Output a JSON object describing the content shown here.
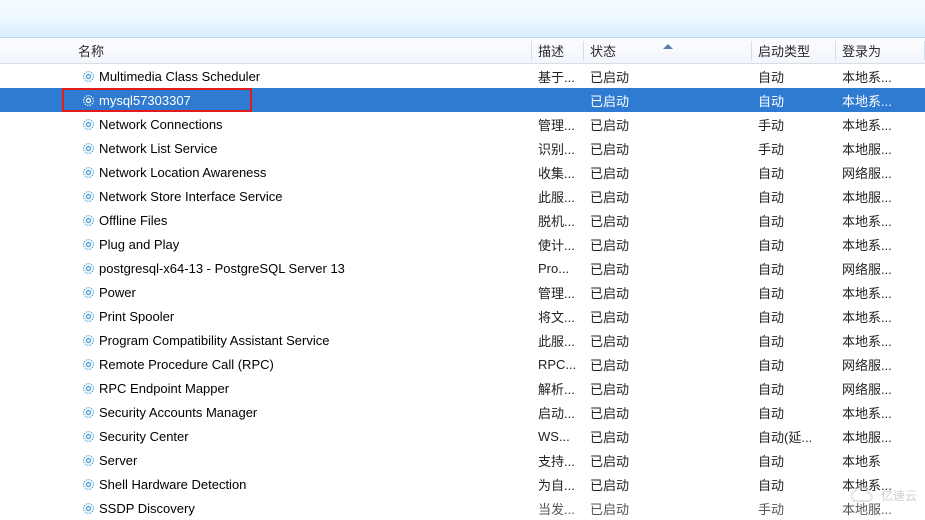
{
  "columns": {
    "name": "名称",
    "desc": "描述",
    "state": "状态",
    "start": "启动类型",
    "logon": "登录为"
  },
  "sort_col": "state",
  "selected_index": 1,
  "highlight_index": 1,
  "services": [
    {
      "name": "Multimedia Class Scheduler",
      "desc": "基于...",
      "state": "已启动",
      "start": "自动",
      "logon": "本地系..."
    },
    {
      "name": "mysql57303307",
      "desc": "",
      "state": "已启动",
      "start": "自动",
      "logon": "本地系..."
    },
    {
      "name": "Network Connections",
      "desc": "管理...",
      "state": "已启动",
      "start": "手动",
      "logon": "本地系..."
    },
    {
      "name": "Network List Service",
      "desc": "识别...",
      "state": "已启动",
      "start": "手动",
      "logon": "本地服..."
    },
    {
      "name": "Network Location Awareness",
      "desc": "收集...",
      "state": "已启动",
      "start": "自动",
      "logon": "网络服..."
    },
    {
      "name": "Network Store Interface Service",
      "desc": "此服...",
      "state": "已启动",
      "start": "自动",
      "logon": "本地服..."
    },
    {
      "name": "Offline Files",
      "desc": "脱机...",
      "state": "已启动",
      "start": "自动",
      "logon": "本地系..."
    },
    {
      "name": "Plug and Play",
      "desc": "使计...",
      "state": "已启动",
      "start": "自动",
      "logon": "本地系..."
    },
    {
      "name": "postgresql-x64-13 - PostgreSQL Server 13",
      "desc": "Pro...",
      "state": "已启动",
      "start": "自动",
      "logon": "网络服..."
    },
    {
      "name": "Power",
      "desc": "管理...",
      "state": "已启动",
      "start": "自动",
      "logon": "本地系..."
    },
    {
      "name": "Print Spooler",
      "desc": "将文...",
      "state": "已启动",
      "start": "自动",
      "logon": "本地系..."
    },
    {
      "name": "Program Compatibility Assistant Service",
      "desc": "此服...",
      "state": "已启动",
      "start": "自动",
      "logon": "本地系..."
    },
    {
      "name": "Remote Procedure Call (RPC)",
      "desc": "RPC...",
      "state": "已启动",
      "start": "自动",
      "logon": "网络服..."
    },
    {
      "name": "RPC Endpoint Mapper",
      "desc": "解析...",
      "state": "已启动",
      "start": "自动",
      "logon": "网络服..."
    },
    {
      "name": "Security Accounts Manager",
      "desc": "启动...",
      "state": "已启动",
      "start": "自动",
      "logon": "本地系..."
    },
    {
      "name": "Security Center",
      "desc": "WS...",
      "state": "已启动",
      "start": "自动(延...",
      "logon": "本地服..."
    },
    {
      "name": "Server",
      "desc": "支持...",
      "state": "已启动",
      "start": "自动",
      "logon": "本地系"
    },
    {
      "name": "Shell Hardware Detection",
      "desc": "为自...",
      "state": "已启动",
      "start": "自动",
      "logon": "本地系..."
    },
    {
      "name": "SSDP Discovery",
      "desc": "当发...",
      "state": "已启动",
      "start": "手动",
      "logon": "本地服..."
    }
  ],
  "watermark": "亿速云"
}
